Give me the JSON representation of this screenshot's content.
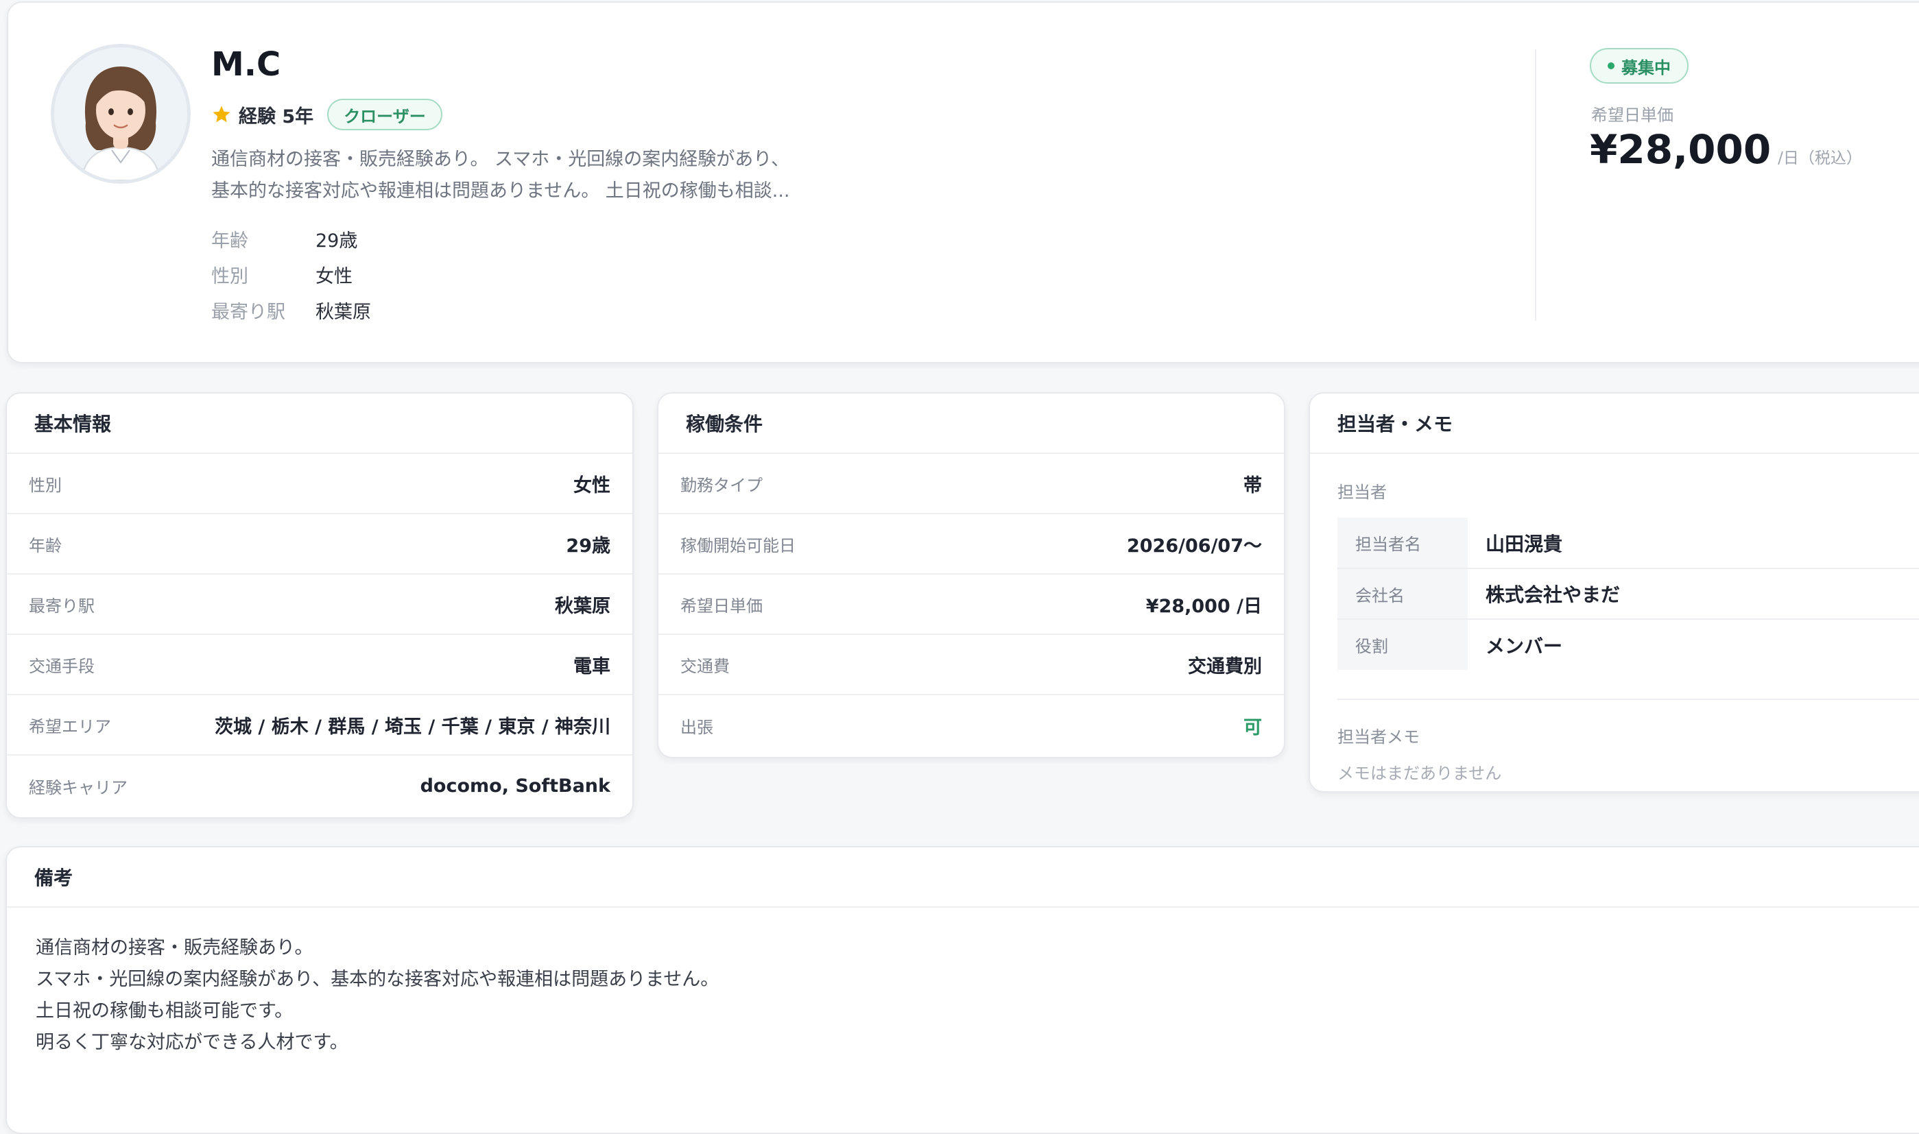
{
  "profile": {
    "name": "M.C",
    "experience": "経験 5年",
    "role_tag": "クローザー",
    "summary_line1": "通信商材の接客・販売経験あり。 スマホ・光回線の案内経験があり、",
    "summary_line2": "基本的な接客対応や報連相は問題ありません。 土日祝の稼働も相談...",
    "facts": [
      {
        "label": "年齢",
        "value": "29歳"
      },
      {
        "label": "性別",
        "value": "女性"
      },
      {
        "label": "最寄り駅",
        "value": "秋葉原"
      }
    ],
    "status": "募集中",
    "rate_label": "希望日単価",
    "rate_value": "¥28,000",
    "rate_unit": "/日（税込）",
    "icons": {
      "star": "star-icon",
      "avatar": "avatar-illustration"
    },
    "colors": {
      "accent_green": "#2a8f63",
      "star": "#f4b400"
    }
  },
  "basic": {
    "title": "基本情報",
    "rows": [
      {
        "label": "性別",
        "value": "女性"
      },
      {
        "label": "年齢",
        "value": "29歳"
      },
      {
        "label": "最寄り駅",
        "value": "秋葉原"
      },
      {
        "label": "交通手段",
        "value": "電車"
      },
      {
        "label": "希望エリア",
        "value": "茨城 / 栃木 / 群馬 / 埼玉 / 千葉 / 東京 / 神奈川"
      },
      {
        "label": "経験キャリア",
        "value": "docomo, SoftBank"
      }
    ]
  },
  "work": {
    "title": "稼働条件",
    "rows": [
      {
        "label": "勤務タイプ",
        "value": "帯"
      },
      {
        "label": "稼働開始可能日",
        "value": "2026/06/07〜"
      },
      {
        "label": "希望日単価",
        "value": "¥28,000 /日"
      },
      {
        "label": "交通費",
        "value": "交通費別"
      },
      {
        "label": "出張",
        "value": "可"
      }
    ]
  },
  "staff": {
    "title": "担当者・メモ",
    "section_label": "担当者",
    "rows": [
      {
        "label": "担当者名",
        "value": "山田滉貴"
      },
      {
        "label": "会社名",
        "value": "株式会社やまだ"
      },
      {
        "label": "役割",
        "value": "メンバー"
      }
    ],
    "memo_label": "担当者メモ",
    "memo_empty": "メモはまだありません"
  },
  "remarks": {
    "title": "備考",
    "lines": [
      "通信商材の接客・販売経験あり。",
      "スマホ・光回線の案内経験があり、基本的な接客対応や報連相は問題ありません。",
      "土日祝の稼働も相談可能です。",
      "明るく丁寧な対応ができる人材です。"
    ]
  }
}
